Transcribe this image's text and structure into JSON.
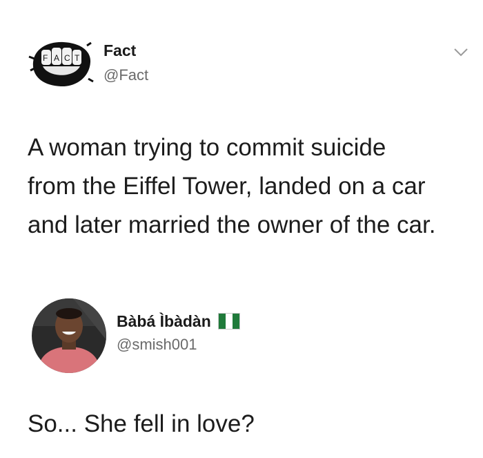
{
  "tweet": {
    "author_name": "Fact",
    "author_handle": "@Fact",
    "avatar_logo_text": "FACT",
    "menu_icon": "chevron-down-icon",
    "text_lines": [
      "A woman trying to commit suicide",
      "from the Eiffel Tower, landed on a car",
      "and later married the owner of the car."
    ]
  },
  "reply": {
    "author_name": "Bàbá Ìbàdàn",
    "author_handle": "@smish001",
    "flag_icon": "nigeria-flag-icon",
    "text": "So... She fell in love?"
  },
  "colors": {
    "text": "#1c1c1c",
    "handle": "#6a6a6a",
    "flag_green": "#1f7a3a",
    "background": "#ffffff"
  }
}
